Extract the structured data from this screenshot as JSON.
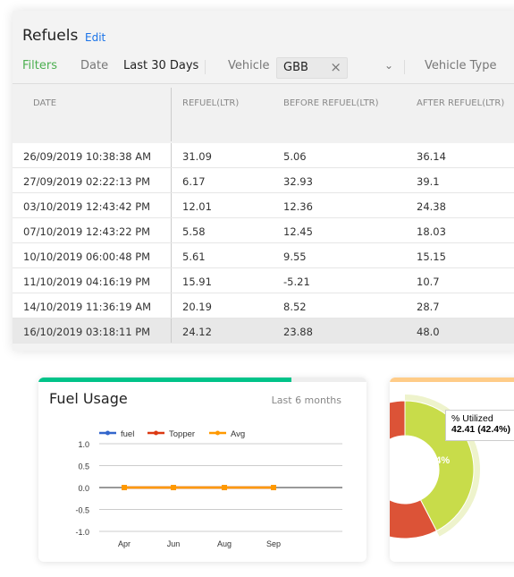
{
  "header": {
    "title": "Refuels",
    "edit_label": "Edit"
  },
  "filters": {
    "label": "Filters",
    "date_label": "Date",
    "date_value": "Last 30 Days",
    "vehicle_label": "Vehicle",
    "vehicle_value": "GBB",
    "vehicle_type_label": "Vehicle Type"
  },
  "table": {
    "columns": [
      "DATE",
      "REFUEL(LTR)",
      "BEFORE REFUEL(LTR)",
      "AFTER REFUEL(LTR)"
    ],
    "rows": [
      [
        "26/09/2019 10:38:38 AM",
        "31.09",
        "5.06",
        "36.14"
      ],
      [
        "27/09/2019 02:22:13 PM",
        "6.17",
        "32.93",
        "39.1"
      ],
      [
        "03/10/2019 12:43:42 PM",
        "12.01",
        "12.36",
        "24.38"
      ],
      [
        "07/10/2019 12:43:22 PM",
        "5.58",
        "12.45",
        "18.03"
      ],
      [
        "10/10/2019 06:00:48 PM",
        "5.61",
        "9.55",
        "15.15"
      ],
      [
        "11/10/2019 04:16:19 PM",
        "15.91",
        "-5.21",
        "10.7"
      ],
      [
        "14/10/2019 11:36:19 AM",
        "20.19",
        "8.52",
        "28.7"
      ],
      [
        "16/10/2019 03:18:11 PM",
        "24.12",
        "23.88",
        "48.0"
      ]
    ],
    "selected_row": 7
  },
  "fuel_card": {
    "title": "Fuel Usage",
    "period": "Last 6 months",
    "accent": "#00c389",
    "progress": 0.77
  },
  "chart_data": {
    "type": "line",
    "categories": [
      "Apr",
      "Jun",
      "Aug",
      "Sep"
    ],
    "ylim": [
      -1,
      1
    ],
    "yticks": [
      "1.0",
      "0.5",
      "0.0",
      "-0.5",
      "-1.0"
    ],
    "grid": true,
    "legend": "top",
    "series": [
      {
        "name": "fuel",
        "color": "#3366cc",
        "values": [
          0,
          0,
          0,
          0
        ]
      },
      {
        "name": "Topper",
        "color": "#dc3912",
        "values": [
          0,
          0,
          0,
          0
        ]
      },
      {
        "name": "Avg",
        "color": "#ff9900",
        "values": [
          0,
          0,
          0,
          0
        ]
      }
    ]
  },
  "util_card": {
    "accent": "#ffcc88",
    "slices": [
      {
        "label": "% Utilized",
        "value": 42.41,
        "color": "#c8dc4a"
      },
      {
        "value": 57.59,
        "color": "#dc5337"
      }
    ],
    "slice_label": "42.4%",
    "tooltip_title": "% Utilized",
    "tooltip_value": "42.41 (42.4%)"
  }
}
